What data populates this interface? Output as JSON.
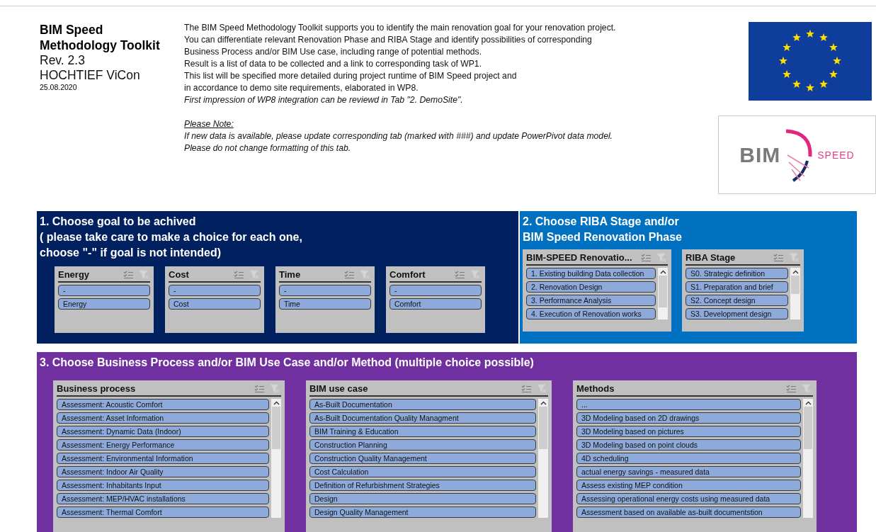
{
  "header": {
    "title": "BIM Speed Methodology Toolkit",
    "revision": "Rev. 2.3",
    "company": "HOCHTIEF ViCon",
    "date": "25.08.2020",
    "description": [
      "The BIM Speed Methodology Toolkit supports you to identify the main renovation goal for your renovation project.",
      "You can differentiate relevant Renovation Phase and RIBA Stage and identify possibilities of corresponding",
      "Business Process and/or BIM Use case, including range of potential methods.",
      "Result is a list of data to be collected and a link to corresponding task of WP1.",
      "This list will be specified more detailed during project runtime of BIM Speed project and",
      "in accordance to demo site requirements, elaborated in WP8."
    ],
    "impression": "First impression of WP8 integration can be reviewd in Tab \"2. DemoSite\".",
    "note_title": "Please Note:",
    "notes": [
      "If new data is available, please update corresponding tab (marked with ###) and update PowerPivot data model.",
      "Please do not change formatting of this tab."
    ],
    "logo": {
      "word1": "BIM",
      "word2": "SPEED"
    }
  },
  "goal_section": {
    "title": [
      "1. Choose goal to be achived",
      "( please take care to make a choice for each one,",
      "choose \"-\" if goal is not intended)"
    ],
    "slicers": [
      {
        "title": "Energy",
        "items": [
          "-",
          "Energy"
        ]
      },
      {
        "title": "Cost",
        "items": [
          "-",
          "Cost"
        ]
      },
      {
        "title": "Time",
        "items": [
          "-",
          "Time"
        ]
      },
      {
        "title": "Comfort",
        "items": [
          "-",
          "Comfort"
        ]
      }
    ]
  },
  "stage_section": {
    "title": [
      "2. Choose RIBA Stage and/or",
      "BIM Speed Renovation Phase"
    ],
    "slicers": [
      {
        "title": "BIM-SPEED Renovatio...",
        "items": [
          "1. Existing building Data collection",
          "2. Renovation Design",
          "3. Performance Analysis",
          "4. Execution of Renovation works"
        ]
      },
      {
        "title": "RIBA Stage",
        "items": [
          "S0. Strategic definition",
          "S1. Preparation and brief",
          "S2. Concept design",
          "S3. Development design"
        ]
      }
    ]
  },
  "process_section": {
    "title": "3. Choose Business Process and/or BIM Use Case and/or Method (multiple choice possible)",
    "slicers": [
      {
        "title": "Business process",
        "items": [
          "Assessment: Acoustic Comfort",
          "Assessment: Asset Information",
          "Assessment: Dynamic Data (Indoor)",
          "Assessment: Energy Performance",
          "Assessment: Environmental Information",
          "Assessment: Indoor Air Quality",
          "Assessment: Inhabitants Input",
          "Assessment: MEP/HVAC installations",
          "Assessment: Thermal Comfort"
        ]
      },
      {
        "title": "BIM use case",
        "items": [
          "As-Built Documentation",
          "As-Built Documentation Quality Managment",
          "BIM Training & Education",
          "Construction Planning",
          "Construction Quality Management",
          "Cost Calculation",
          "Definition of Refurbishment Strategies",
          "Design",
          "Design Quality Management"
        ]
      },
      {
        "title": "Methods",
        "items": [
          "...",
          "3D Modeling based on 2D drawings",
          "3D Modeling based on pictures",
          "3D Modeling based on point clouds",
          "4D scheduling",
          "actual energy savings - measured data",
          "Assess existing MEP condition",
          "Assessing operational energy costs using measured data",
          "Assessment based on available as-built documentstion"
        ]
      }
    ]
  }
}
